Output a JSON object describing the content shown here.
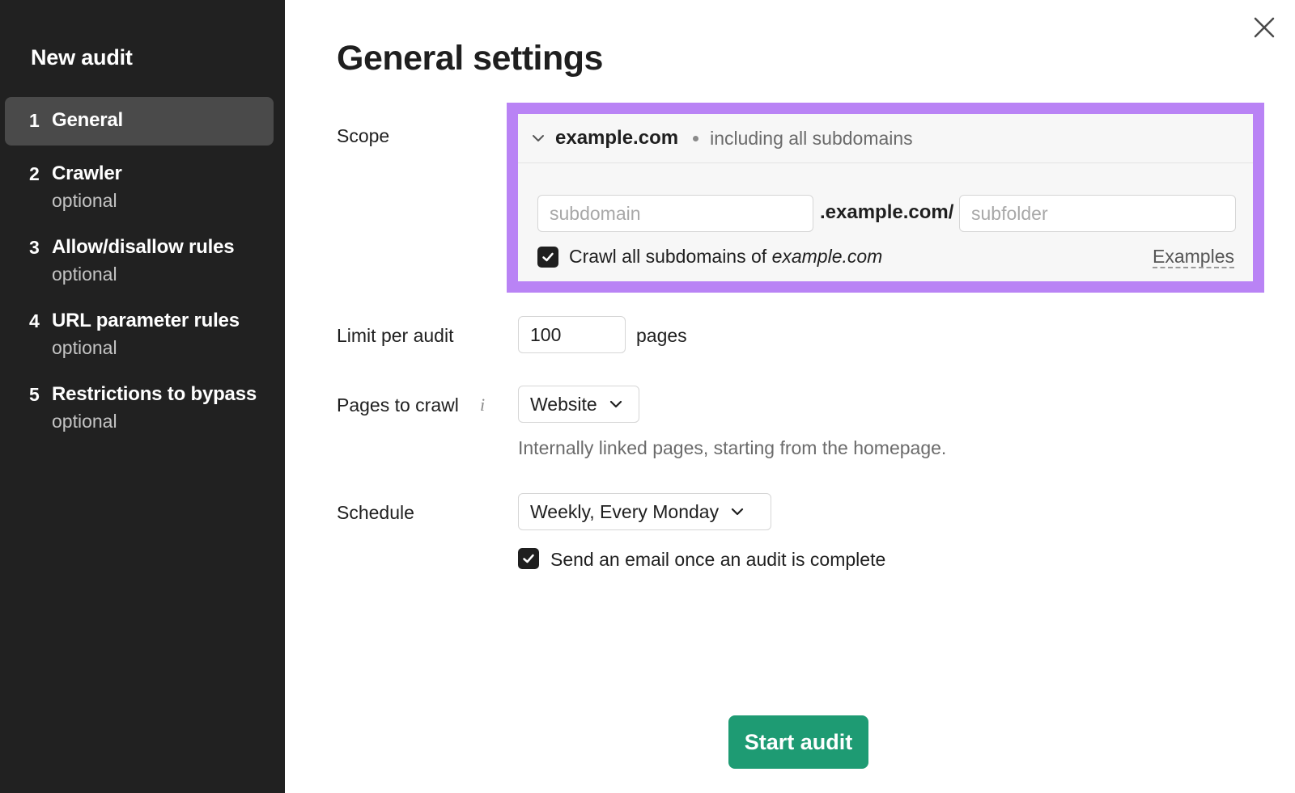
{
  "sidebar": {
    "title": "New audit",
    "steps": [
      {
        "num": "1",
        "label": "General",
        "sub": ""
      },
      {
        "num": "2",
        "label": "Crawler",
        "sub": "optional"
      },
      {
        "num": "3",
        "label": "Allow/disallow rules",
        "sub": "optional"
      },
      {
        "num": "4",
        "label": "URL parameter rules",
        "sub": "optional"
      },
      {
        "num": "5",
        "label": "Restrictions to bypass",
        "sub": "optional"
      }
    ]
  },
  "main": {
    "title": "General settings",
    "scope": {
      "label": "Scope",
      "domain": "example.com",
      "include_text": "including all subdomains",
      "subdomain_placeholder": "subdomain",
      "middle_text": ".example.com/",
      "subfolder_placeholder": "subfolder",
      "crawl_label_prefix": "Crawl all subdomains of ",
      "crawl_label_domain": "example.com",
      "crawl_checked": true,
      "examples_link": "Examples"
    },
    "limit": {
      "label": "Limit per audit",
      "value": "100",
      "unit": "pages"
    },
    "pages_to_crawl": {
      "label": "Pages to crawl",
      "info_icon": "i",
      "selected": "Website",
      "hint": "Internally linked pages, starting from the homepage."
    },
    "schedule": {
      "label": "Schedule",
      "selected": "Weekly, Every Monday",
      "email_label": "Send an email once an audit is complete",
      "email_checked": true
    },
    "start_button": "Start audit"
  },
  "colors": {
    "sidebar_bg": "#212121",
    "active_step_bg": "#4a4a4a",
    "highlight": "#b983f5",
    "primary_button": "#1e9b73"
  }
}
